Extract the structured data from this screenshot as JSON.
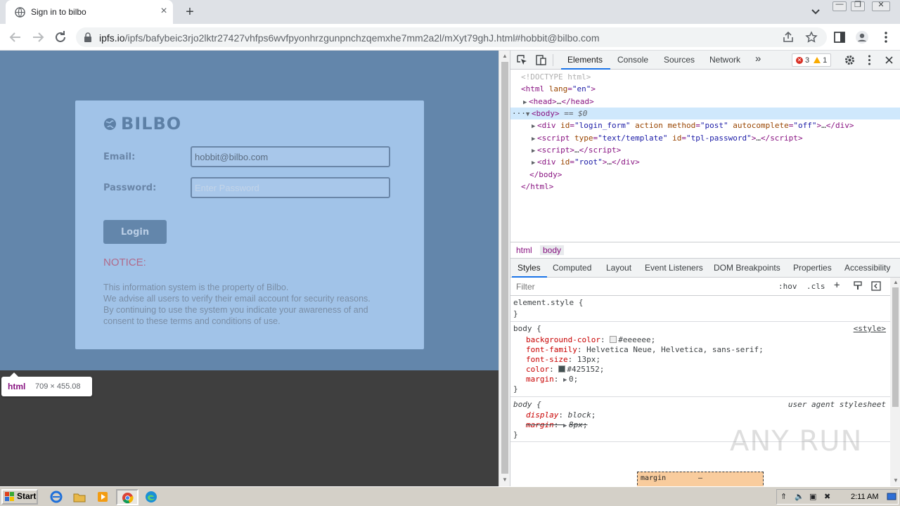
{
  "browser": {
    "tab_title": "Sign in to bilbo",
    "tab_close": "×",
    "new_tab": "+",
    "url_host": "ipfs.io",
    "url_rest": "/ipfs/bafybeic3rjo2lktr27427vhfps6wvfpyonhrzgunpnchzqemxhe7mm2a2l/mXyt79ghJ.html#hobbit@bilbo.com",
    "window_controls": [
      "—",
      "❐",
      "✕"
    ]
  },
  "page": {
    "brand": "BILBO",
    "email_label": "Email:",
    "email_value": "hobbit@bilbo.com",
    "password_label": "Password:",
    "password_placeholder": "Enter Password",
    "login_button": "Login",
    "notice_title": "NOTICE:",
    "notice_lines": [
      "This information system is the property of Bilbo.",
      "We advise all users to verify their email account for security reasons.",
      "By continuing to use the system you indicate your awareness of and",
      "consent to these terms and conditions of use."
    ],
    "tooltip_tag": "html",
    "tooltip_size": "709 × 455.08"
  },
  "devtools": {
    "tabs": [
      "Elements",
      "Console",
      "Sources",
      "Network"
    ],
    "more_tabs": "»",
    "error_count": "3",
    "warning_count": "1",
    "dom": {
      "doctype": "<!DOCTYPE html>",
      "html_open_tag": "html",
      "html_attr": "lang",
      "html_attr_val": "\"en\"",
      "head": "head",
      "head_ellipsis": "…",
      "body": "body",
      "selected_marker": "== $0",
      "div1_attr1": "id",
      "div1_val1": "\"login_form\"",
      "div1_attr2": "action",
      "div1_attr3": "method",
      "div1_val3": "\"post\"",
      "div1_attr4": "autocomplete",
      "div1_val4": "\"off\"",
      "script_attr1": "type",
      "script_val1": "\"text/template\"",
      "script_attr2": "id",
      "script_val2": "\"tpl-password\"",
      "div2_attr": "id",
      "div2_val": "\"root\"",
      "div_tag": "div",
      "script_tag": "script",
      "ellipsis_dots": "···"
    },
    "breadcrumbs": [
      "html",
      "body"
    ],
    "subtabs": [
      "Styles",
      "Computed",
      "Layout",
      "Event Listeners",
      "DOM Breakpoints",
      "Properties",
      "Accessibility"
    ],
    "filter_placeholder": "Filter",
    "filter_opts": [
      ":hov",
      ".cls",
      "+"
    ],
    "styles": {
      "element_style": "element.style {",
      "close_brace": "}",
      "body_selector": "body {",
      "body_source": "<style>",
      "props": [
        {
          "name": "background-color",
          "value": "#eeeeee",
          "swatch": "#eeeeee"
        },
        {
          "name": "font-family",
          "value": "Helvetica Neue, Helvetica, sans-serif"
        },
        {
          "name": "font-size",
          "value": "13px"
        },
        {
          "name": "color",
          "value": "#425152",
          "swatch": "#425152"
        },
        {
          "name": "margin",
          "value": "0"
        }
      ],
      "ua_selector": "body {",
      "ua_source": "user agent stylesheet",
      "ua_props": [
        {
          "name": "display",
          "value": "block"
        },
        {
          "name": "margin",
          "value": "8px"
        }
      ],
      "boxmodel_label": "margin",
      "boxmodel_value": "–"
    }
  },
  "watermark": "ANY RUN",
  "taskbar": {
    "start": "Start",
    "clock": "2:11 AM"
  }
}
